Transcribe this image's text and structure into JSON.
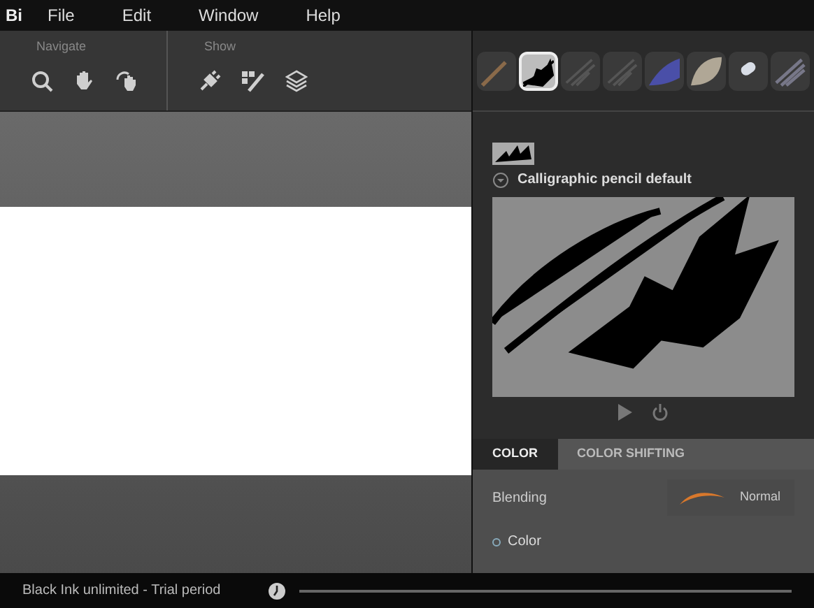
{
  "app_logo": "Bi",
  "menu": [
    "File",
    "Edit",
    "Window",
    "Help"
  ],
  "toolbar_groups": [
    {
      "title": "Navigate",
      "tools": [
        {
          "kind": "search"
        },
        {
          "kind": "hand"
        },
        {
          "kind": "rotate"
        }
      ]
    },
    {
      "title": "Show",
      "tools": [
        {
          "kind": "plug"
        },
        {
          "kind": "brush"
        },
        {
          "kind": "layers"
        }
      ]
    }
  ],
  "brushes": [
    {
      "kind": "pen",
      "selected": false
    },
    {
      "kind": "calligraphic",
      "selected": true
    },
    {
      "kind": "pencil",
      "selected": false
    },
    {
      "kind": "pencil",
      "selected": false
    },
    {
      "kind": "watercolor",
      "selected": false
    },
    {
      "kind": "smudge",
      "selected": false
    },
    {
      "kind": "eraser",
      "selected": false
    },
    {
      "kind": "hatch",
      "selected": false
    }
  ],
  "brush_name": "Calligraphic pencil default",
  "tabs": [
    {
      "label": "COLOR",
      "selected": true
    },
    {
      "label": "COLOR SHIFTING",
      "selected": false
    }
  ],
  "blending": {
    "label": "Blending",
    "value": "Normal"
  },
  "color_row": {
    "label": "Color"
  },
  "status_bar": {
    "text": "Black Ink unlimited - Trial period"
  }
}
